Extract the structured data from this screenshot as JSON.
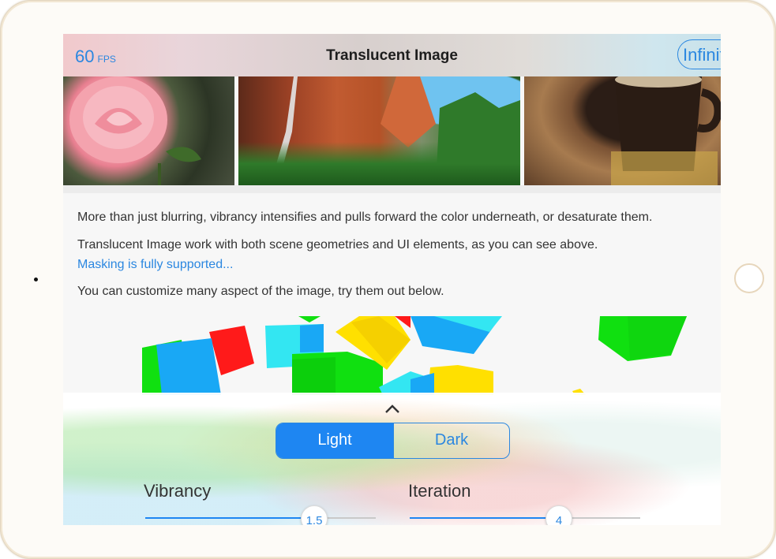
{
  "navbar": {
    "fps_value": "60",
    "fps_unit": "FPS",
    "title": "Translucent Image",
    "right_button_label": "Infinite"
  },
  "gallery": {
    "images": [
      "rose",
      "canyon-waterfall",
      "coffee-cup"
    ]
  },
  "content": {
    "para1": "More than just blurring, vibrancy intensifies and pulls forward the color underneath, or desaturate them.",
    "para2": "Translucent Image work with both scene geometries and UI elements, as you can see above.",
    "link": "Masking is fully supported...",
    "para3": "You can customize many aspect of the image, try them out below."
  },
  "panel": {
    "segments": [
      "Light",
      "Dark"
    ],
    "selected_segment": "Light",
    "sliders": [
      {
        "label": "Vibrancy",
        "value": "1.5",
        "fill_fraction": 0.72
      },
      {
        "label": "Iteration",
        "value": "4",
        "fill_fraction": 0.65
      }
    ]
  },
  "colors": {
    "accent": "#2b87e0",
    "segment_selected": "#1e86f2",
    "cube_green": "#10e010",
    "cube_blue": "#19a8f5",
    "cube_cyan": "#33e6f2",
    "cube_yellow": "#ffe000",
    "cube_red": "#ff1a1a"
  }
}
